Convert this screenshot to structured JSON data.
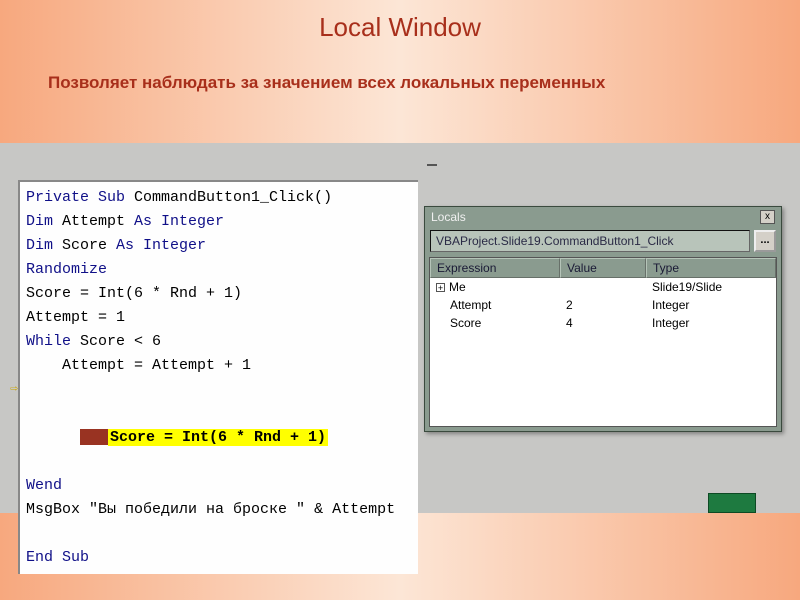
{
  "title": "Local Window",
  "subtitle": "Позволяет наблюдать за значением всех локальных переменных",
  "code": {
    "l1a": "Private Sub",
    "l1b": " CommandButton1_Click()",
    "l2a": "Dim",
    "l2b": " Attempt ",
    "l2c": "As Integer",
    "l3a": "Dim",
    "l3b": " Score ",
    "l3c": "As Integer",
    "l4": "Randomize",
    "l5": "Score = Int(6 * Rnd + 1)",
    "l6": "Attempt = 1",
    "l7a": "While",
    "l7b": " Score < 6",
    "l8": "    Attempt = Attempt + 1",
    "l9": "Score = Int(6 * Rnd + 1)",
    "l10": "Wend",
    "l11a": "MsgBox ",
    "l11b": "\"Вы победили на броске \"",
    "l11c": " & Attempt",
    "l12": "End Sub",
    "arrow": "⇨"
  },
  "locals": {
    "title": "Locals",
    "close": "x",
    "context": "VBAProject.Slide19.CommandButton1_Click",
    "dots": "...",
    "headers": {
      "expression": "Expression",
      "value": "Value",
      "type": "Type"
    },
    "rows": [
      {
        "exp": "Me",
        "val": "",
        "typ": "Slide19/Slide",
        "expandable": true,
        "expand_symbol": "+"
      },
      {
        "exp": "Attempt",
        "val": "2",
        "typ": "Integer",
        "expandable": false
      },
      {
        "exp": "Score",
        "val": "4",
        "typ": "Integer",
        "expandable": false
      }
    ]
  }
}
